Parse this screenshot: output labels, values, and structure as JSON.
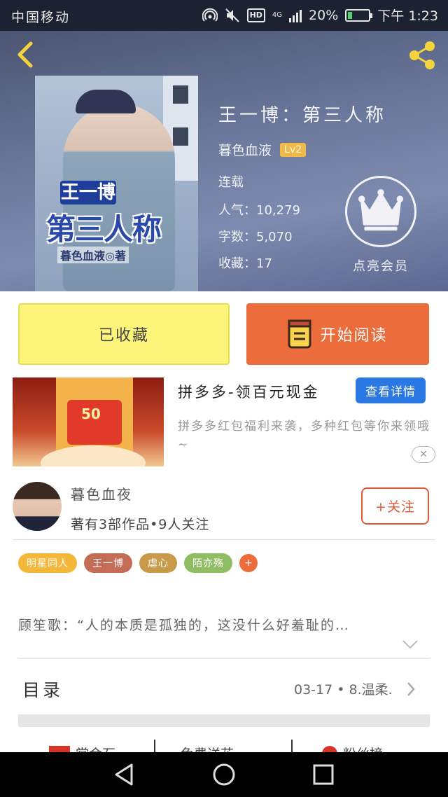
{
  "status_bar": {
    "carrier": "中国移动",
    "network": "4G",
    "hd": "HD",
    "battery_percent": "20%",
    "battery_level": 0.2,
    "time": "下午 1:23"
  },
  "book": {
    "title": "王一博：第三人称",
    "author": "暮色血液",
    "level": "Lv2",
    "status": "连载",
    "popularity": "人气：10,279",
    "word_count": "字数：5,070",
    "favorites": "收藏：17",
    "cover": {
      "line1": "王一博",
      "line2": "第三人称",
      "line3": "暮色血液◎著"
    }
  },
  "vip": {
    "label": "点亮会员"
  },
  "actions": {
    "collected_label": "已收藏",
    "read_label": "开始阅读"
  },
  "ad": {
    "image_amount": "50",
    "title": "拼多多-领百元现金",
    "detail_button": "查看详情",
    "description": "拼多多红包福利来袭，多种红包等你来领哦~",
    "close_symbol": "✕"
  },
  "author_card": {
    "name": "暮色血夜",
    "stats": "著有3部作品•9人关注",
    "follow_label": "+关注"
  },
  "tags": [
    {
      "label": "明星同人",
      "color": "#f4b73a"
    },
    {
      "label": "王一博",
      "color": "#c46c55"
    },
    {
      "label": "虐心",
      "color": "#c99a4a"
    },
    {
      "label": "陌亦殇",
      "color": "#8fbd63"
    }
  ],
  "tag_more": "+",
  "intro": "顾笙歌：“人的本质是孤独的，这没什么好羞耻的…",
  "toc": {
    "label": "目录",
    "latest": "03-17 • 8.温柔."
  },
  "bottom_tabs": [
    "赏金石",
    "免费送花",
    "粉丝榜"
  ],
  "colors": {
    "accent_orange": "#ec6c3b",
    "collected_yellow": "#fcf57a",
    "detail_blue": "#2a78e4",
    "status_bar_bg": "#1c2232"
  }
}
